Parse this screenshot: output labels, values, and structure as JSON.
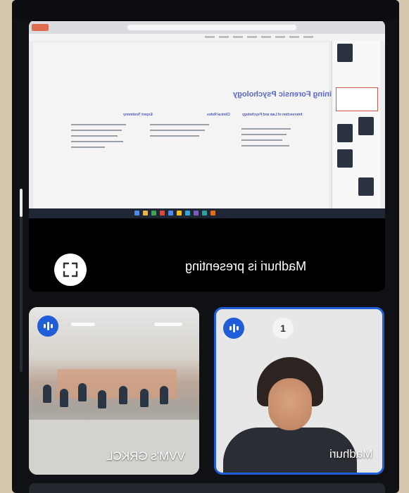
{
  "presentation": {
    "slide_title": "Defining Forensic Psychology",
    "columns": [
      "Intersection of Law and Psychology",
      "Clinical Roles",
      "Expert Testimony"
    ],
    "presenting_text": "Madhuri is presenting"
  },
  "participants": [
    {
      "name": "VVM's GRKCL",
      "speaking": true
    },
    {
      "name": "Madhuri",
      "speaking": true,
      "hand_raised": true,
      "hand_count": "1"
    }
  ],
  "colors": {
    "accent": "#1f5ed8",
    "background": "#0f1115",
    "slide_title": "#5867c4"
  },
  "icons": [
    "fullscreen-icon",
    "speaker-icon",
    "raised-hand-icon"
  ]
}
